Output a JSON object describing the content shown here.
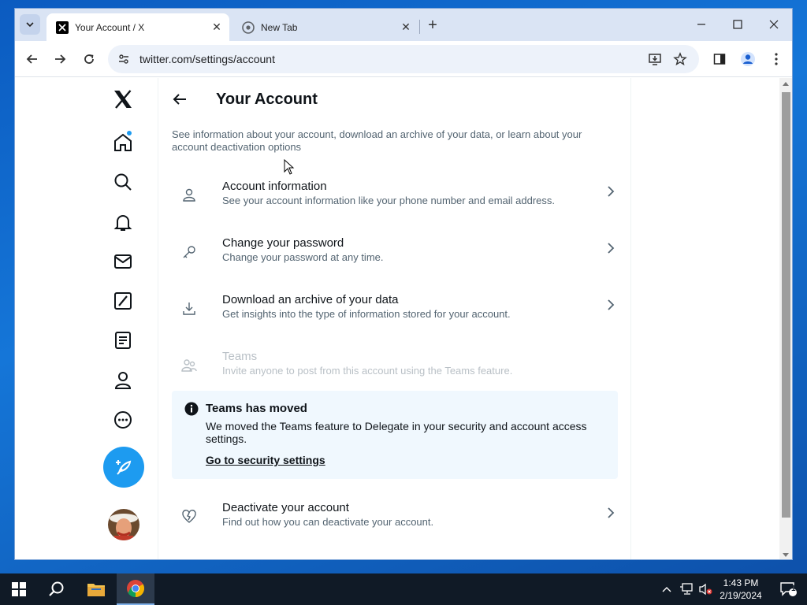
{
  "browser": {
    "tabs": [
      {
        "title": "Your Account / X",
        "active": true
      },
      {
        "title": "New Tab",
        "active": false
      }
    ],
    "url": "twitter.com/settings/account"
  },
  "page": {
    "title": "Your Account",
    "description": "See information about your account, download an archive of your data, or learn about your account deactivation options",
    "rows": [
      {
        "title": "Account information",
        "subtitle": "See your account information like your phone number and email address."
      },
      {
        "title": "Change your password",
        "subtitle": "Change your password at any time."
      },
      {
        "title": "Download an archive of your data",
        "subtitle": "Get insights into the type of information stored for your account."
      },
      {
        "title": "Teams",
        "subtitle": "Invite anyone to post from this account using the Teams feature."
      },
      {
        "title": "Deactivate your account",
        "subtitle": "Find out how you can deactivate your account."
      }
    ],
    "notice": {
      "title": "Teams has moved",
      "text": "We moved the Teams feature to Delegate in your security and account access settings.",
      "link": "Go to security settings"
    }
  },
  "nav": {
    "icons": [
      "x-logo-icon",
      "home-icon",
      "search-icon",
      "bell-icon",
      "mail-icon",
      "grok-icon",
      "lists-icon",
      "profile-icon",
      "more-icon"
    ]
  },
  "taskbar": {
    "time": "1:43 PM",
    "date": "2/19/2024",
    "notifications": "1"
  },
  "colors": {
    "accent": "#1d9bf0",
    "notice_bg": "#f0f8fe"
  }
}
